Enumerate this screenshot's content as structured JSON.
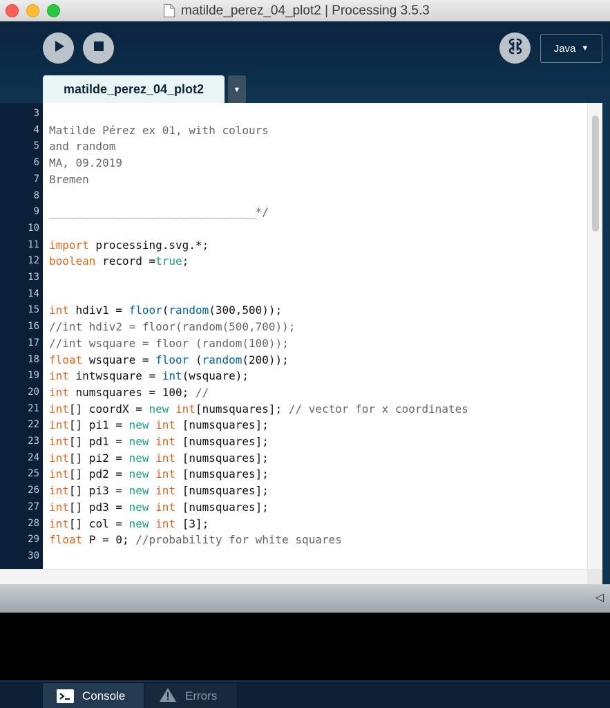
{
  "window": {
    "title": "matilde_perez_04_plot2 | Processing 3.5.3"
  },
  "toolbar": {
    "run_icon": "play-icon",
    "stop_icon": "stop-icon",
    "debug_icon": "debugger-icon",
    "mode_label": "Java",
    "mode_arrow": "▼"
  },
  "tabs": {
    "active_label": "matilde_perez_04_plot2",
    "menu_arrow": "▼"
  },
  "editor": {
    "line_numbers": [
      "3",
      "4",
      "5",
      "6",
      "7",
      "8",
      "9",
      "10",
      "11",
      "12",
      "13",
      "14",
      "15",
      "16",
      "17",
      "18",
      "19",
      "20",
      "21",
      "22",
      "23",
      "24",
      "25",
      "26",
      "27",
      "28",
      "29",
      "30"
    ],
    "lines": [
      [],
      [
        [
          "c",
          "Matilde Pérez ex 01, with colours"
        ]
      ],
      [
        [
          "c",
          "and random"
        ]
      ],
      [
        [
          "c",
          "MA, 09.2019"
        ]
      ],
      [
        [
          "c",
          "Bremen"
        ]
      ],
      [],
      [
        [
          "c",
          "_______________________________*/"
        ]
      ],
      [],
      [
        [
          "k",
          "import"
        ],
        [
          "t",
          " processing.svg.*;"
        ]
      ],
      [
        [
          "k",
          "boolean"
        ],
        [
          "t",
          " record ="
        ],
        [
          "l",
          "true"
        ],
        [
          "t",
          ";"
        ]
      ],
      [],
      [],
      [
        [
          "k",
          "int"
        ],
        [
          "t",
          " hdiv1 = "
        ],
        [
          "f",
          "floor"
        ],
        [
          "t",
          "("
        ],
        [
          "f",
          "random"
        ],
        [
          "t",
          "(300,500));"
        ]
      ],
      [
        [
          "c",
          "//int hdiv2 = floor(random(500,700));"
        ]
      ],
      [
        [
          "c",
          "//int wsquare = floor (random(100));"
        ]
      ],
      [
        [
          "k",
          "float"
        ],
        [
          "t",
          " wsquare = "
        ],
        [
          "f",
          "floor"
        ],
        [
          "t",
          " ("
        ],
        [
          "f",
          "random"
        ],
        [
          "t",
          "(200));"
        ]
      ],
      [
        [
          "k",
          "int"
        ],
        [
          "t",
          " intwsquare = "
        ],
        [
          "f",
          "int"
        ],
        [
          "t",
          "(wsquare);"
        ]
      ],
      [
        [
          "k",
          "int"
        ],
        [
          "t",
          " numsquares = 100; "
        ],
        [
          "c",
          "//"
        ]
      ],
      [
        [
          "k",
          "int"
        ],
        [
          "t",
          "[] coordX = "
        ],
        [
          "l",
          "new"
        ],
        [
          "t",
          " "
        ],
        [
          "k",
          "int"
        ],
        [
          "t",
          "[numsquares]; "
        ],
        [
          "c",
          "// vector for x coordinates"
        ]
      ],
      [
        [
          "k",
          "int"
        ],
        [
          "t",
          "[] pi1 = "
        ],
        [
          "l",
          "new"
        ],
        [
          "t",
          " "
        ],
        [
          "k",
          "int"
        ],
        [
          "t",
          " [numsquares];"
        ]
      ],
      [
        [
          "k",
          "int"
        ],
        [
          "t",
          "[] pd1 = "
        ],
        [
          "l",
          "new"
        ],
        [
          "t",
          " "
        ],
        [
          "k",
          "int"
        ],
        [
          "t",
          " [numsquares];"
        ]
      ],
      [
        [
          "k",
          "int"
        ],
        [
          "t",
          "[] pi2 = "
        ],
        [
          "l",
          "new"
        ],
        [
          "t",
          " "
        ],
        [
          "k",
          "int"
        ],
        [
          "t",
          " [numsquares];"
        ]
      ],
      [
        [
          "k",
          "int"
        ],
        [
          "t",
          "[] pd2 = "
        ],
        [
          "l",
          "new"
        ],
        [
          "t",
          " "
        ],
        [
          "k",
          "int"
        ],
        [
          "t",
          " [numsquares];"
        ]
      ],
      [
        [
          "k",
          "int"
        ],
        [
          "t",
          "[] pi3 = "
        ],
        [
          "l",
          "new"
        ],
        [
          "t",
          " "
        ],
        [
          "k",
          "int"
        ],
        [
          "t",
          " [numsquares];"
        ]
      ],
      [
        [
          "k",
          "int"
        ],
        [
          "t",
          "[] pd3 = "
        ],
        [
          "l",
          "new"
        ],
        [
          "t",
          " "
        ],
        [
          "k",
          "int"
        ],
        [
          "t",
          " [numsquares];"
        ]
      ],
      [
        [
          "k",
          "int"
        ],
        [
          "t",
          "[] col = "
        ],
        [
          "l",
          "new"
        ],
        [
          "t",
          " "
        ],
        [
          "k",
          "int"
        ],
        [
          "t",
          " [3];"
        ]
      ],
      [
        [
          "k",
          "float"
        ],
        [
          "t",
          " P = 0; "
        ],
        [
          "c",
          "//probability for white squares"
        ]
      ],
      []
    ],
    "syntax_colors": {
      "keyword": "#e2661a",
      "function": "#006699",
      "literal": "#1aa087",
      "comment": "#666666",
      "text": "#111111"
    }
  },
  "message_area": {
    "collapse_glyph": "◁"
  },
  "console_tabs": {
    "console_label": "Console",
    "errors_label": "Errors",
    "console_icon": "console-icon",
    "errors_icon": "warning-icon"
  }
}
